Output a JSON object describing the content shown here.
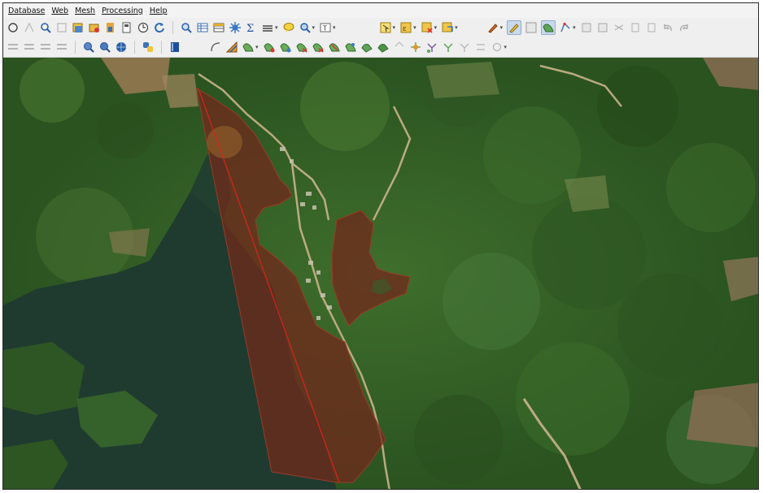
{
  "menubar": {
    "items": [
      {
        "label": "Database"
      },
      {
        "label": "Web"
      },
      {
        "label": "Mesh"
      },
      {
        "label": "Processing"
      },
      {
        "label": "Help"
      }
    ]
  },
  "toolbar_top": {
    "icons": [
      "open-icon",
      "revert-icon",
      "pan-icon",
      "pan-to-selection-icon",
      "zoom-in-icon",
      "zoom-out-icon",
      "zoom-native-icon",
      "zoom-full-icon",
      "new-map-view-icon",
      "temporal-controller-icon",
      "refresh-icon",
      "identify-icon",
      "attribute-table-icon",
      "field-calculator-icon",
      "processing-toolbox-icon",
      "statistics-icon",
      "measure-icon",
      "map-tips-icon",
      "spatial-bookmark-icon",
      "text-annotation-icon",
      "select-features-icon",
      "select-by-expression-icon",
      "deselect-icon",
      "select-by-location-icon",
      "edit-pencil-icon",
      "toggle-editing-icon",
      "save-edits-icon",
      "digitize-icon",
      "vertex-tool-icon",
      "delete-selected-icon",
      "cut-features-icon",
      "copy-features-icon",
      "paste-features-icon",
      "undo-icon",
      "redo-icon"
    ]
  },
  "toolbar_bottom": {
    "icons": [
      "python-console-icon",
      "db-manager-icon",
      "georeferencer-icon",
      "add-layer-icon",
      "osm-search-icon",
      "coordinate-capture-icon",
      "help-book-icon",
      "trace-icon",
      "snapping-icon",
      "add-ring-icon",
      "add-part-icon",
      "fill-ring-icon",
      "delete-ring-icon",
      "delete-part-icon",
      "reshape-icon",
      "offset-curve-icon",
      "split-features-icon",
      "split-parts-icon",
      "merge-features-icon",
      "merge-attributes-icon",
      "rotate-point-symbols-icon",
      "simplify-icon"
    ]
  },
  "map": {
    "layer": "satellite-imagery",
    "overlay_polygon_color": "#6e2a1c",
    "overlay_line_color": "#d8241a"
  },
  "colors": {
    "water": "#1f3b30",
    "forest": "#2f5a24",
    "road": "#c9b48a"
  }
}
